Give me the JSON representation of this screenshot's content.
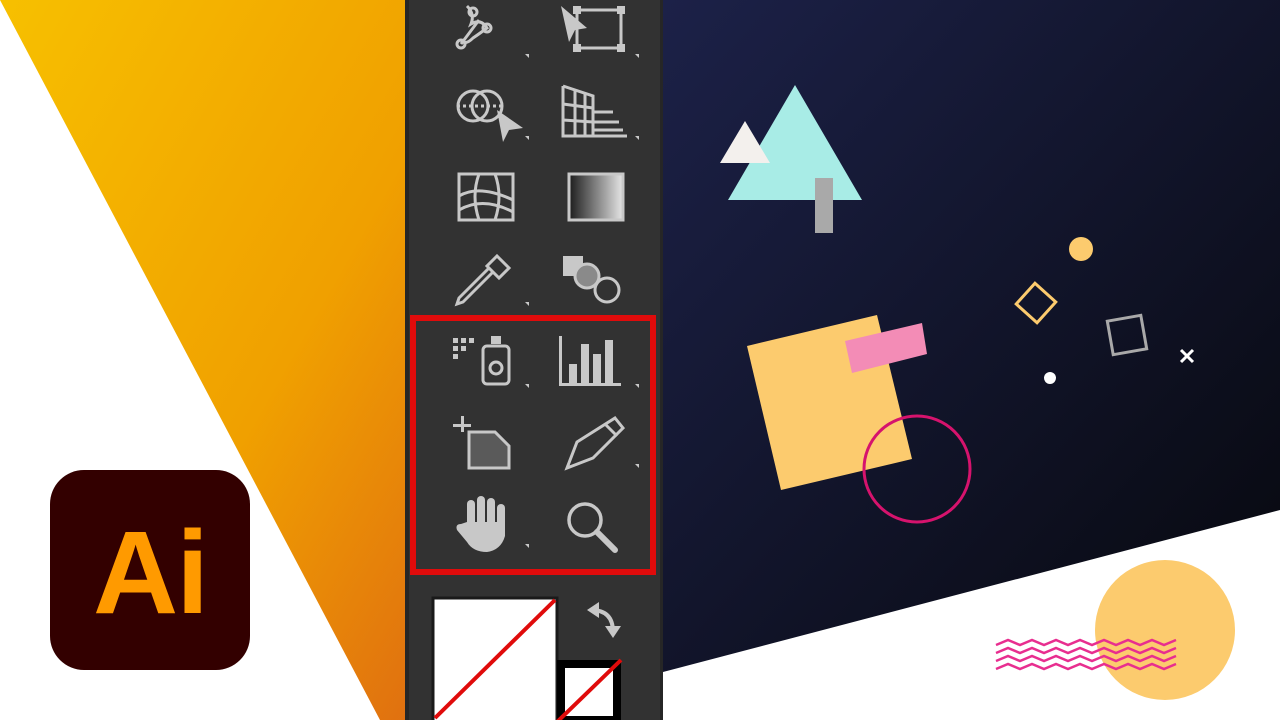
{
  "logo": {
    "text": "Ai",
    "bg_color": "#330000",
    "text_color": "#ff9a00"
  },
  "colors": {
    "gradient_light": "#f6b900",
    "gradient_dark": "#e07a10",
    "panel": "#323232",
    "icon": "#c8c8c8",
    "highlight": "#e00b0b",
    "canvas": "#10132a",
    "shape_yellow": "#fccb6e",
    "shape_teal": "#a8ece6",
    "shape_pink": "#f38cb6",
    "shape_magenta": "#d6136d",
    "shape_gray": "#a9a9a9"
  },
  "toolbar": {
    "tools": [
      {
        "id": "puppet-warp",
        "icon": "puppet-warp-icon"
      },
      {
        "id": "free-transform",
        "icon": "free-transform-icon"
      },
      {
        "id": "shape-builder",
        "icon": "shape-builder-icon"
      },
      {
        "id": "perspective-grid",
        "icon": "perspective-grid-icon"
      },
      {
        "id": "mesh",
        "icon": "mesh-icon"
      },
      {
        "id": "gradient",
        "icon": "gradient-icon"
      },
      {
        "id": "eyedropper",
        "icon": "eyedropper-icon"
      },
      {
        "id": "blend",
        "icon": "blend-icon"
      },
      {
        "id": "symbol-sprayer",
        "icon": "symbol-sprayer-icon"
      },
      {
        "id": "column-graph",
        "icon": "column-graph-icon"
      },
      {
        "id": "artboard",
        "icon": "artboard-icon"
      },
      {
        "id": "slice",
        "icon": "slice-icon"
      },
      {
        "id": "hand",
        "icon": "hand-icon"
      },
      {
        "id": "zoom",
        "icon": "zoom-icon"
      }
    ],
    "highlighted_group": [
      "symbol-sprayer",
      "column-graph",
      "artboard",
      "slice",
      "hand",
      "zoom"
    ],
    "fill_stroke": {
      "fill": "none",
      "stroke": "none",
      "swap_icon": "swap-arrow-icon"
    }
  }
}
